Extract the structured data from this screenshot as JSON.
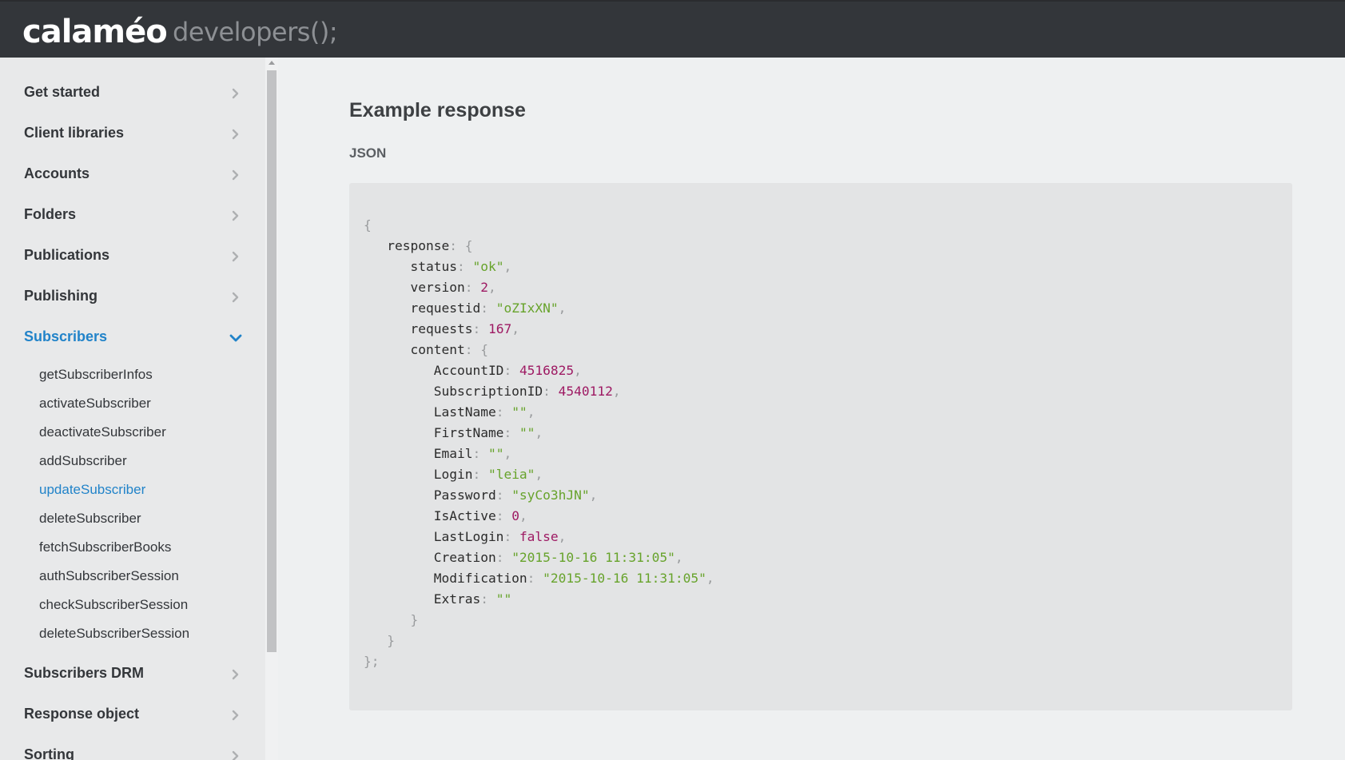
{
  "header": {
    "logo": "calaméo",
    "tagline": "developers();"
  },
  "sidebar": {
    "items": [
      {
        "label": "Get started",
        "expanded": false
      },
      {
        "label": "Client libraries",
        "expanded": false
      },
      {
        "label": "Accounts",
        "expanded": false
      },
      {
        "label": "Folders",
        "expanded": false
      },
      {
        "label": "Publications",
        "expanded": false
      },
      {
        "label": "Publishing",
        "expanded": false
      },
      {
        "label": "Subscribers",
        "expanded": true,
        "active": true
      },
      {
        "label": "Subscribers DRM",
        "expanded": false
      },
      {
        "label": "Response object",
        "expanded": false
      },
      {
        "label": "Sorting",
        "expanded": false
      }
    ],
    "subscribers_subitems": [
      {
        "label": "getSubscriberInfos"
      },
      {
        "label": "activateSubscriber"
      },
      {
        "label": "deactivateSubscriber"
      },
      {
        "label": "addSubscriber"
      },
      {
        "label": "updateSubscriber",
        "active": true
      },
      {
        "label": "deleteSubscriber"
      },
      {
        "label": "fetchSubscriberBooks"
      },
      {
        "label": "authSubscriberSession"
      },
      {
        "label": "checkSubscriberSession"
      },
      {
        "label": "deleteSubscriberSession"
      }
    ]
  },
  "main": {
    "section_title": "Example response",
    "format_label": "JSON",
    "response": {
      "status": "\"ok\"",
      "version": "2",
      "requestid": "\"oZIxXN\"",
      "requests": "167",
      "content": {
        "AccountID": "4516825",
        "SubscriptionID": "4540112",
        "LastName": "\"\"",
        "FirstName": "\"\"",
        "Email": "\"\"",
        "Login": "\"leia\"",
        "Password": "\"syCo3hJN\"",
        "IsActive": "0",
        "LastLogin": "false",
        "Creation": "\"2015-10-16 11:31:05\"",
        "Modification": "\"2015-10-16 11:31:05\"",
        "Extras": "\"\""
      }
    }
  },
  "colors": {
    "header_bg": "#33363a",
    "sidebar_bg": "#e8e9ea",
    "accent": "#2183c9",
    "code_bg": "#e3e4e5",
    "string": "#67a32b",
    "number": "#9e1a63"
  },
  "icons": {
    "collapsed": "chevron-right-icon",
    "expanded": "chevron-down-icon"
  }
}
